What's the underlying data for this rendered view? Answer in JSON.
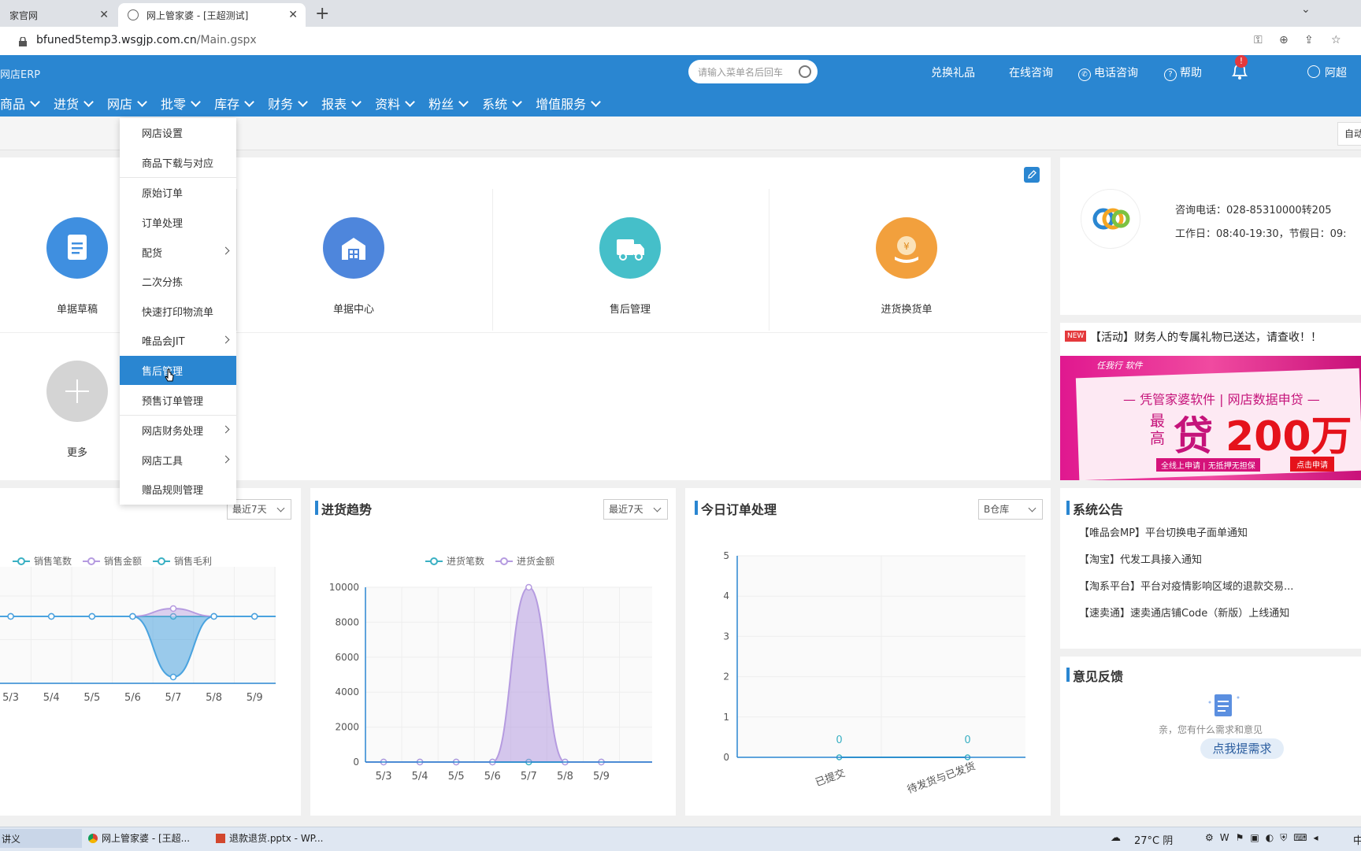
{
  "browser": {
    "tabs": [
      {
        "label": "家官网"
      },
      {
        "label": "网上管家婆 - [王超测试]"
      }
    ],
    "url_host": "bfuned5temp3.wsgjp.com.cn",
    "url_path": "/Main.gspx"
  },
  "header": {
    "logo_text": "网店ERP",
    "search_placeholder": "请输入菜单名后回车",
    "links": {
      "exchange": "兑换礼品",
      "online": "在线咨询",
      "phone": "电话咨询",
      "help": "帮助",
      "user": "阿超"
    },
    "notification_badge": "!"
  },
  "nav": [
    "商品",
    "进货",
    "网店",
    "批零",
    "库存",
    "财务",
    "报表",
    "资料",
    "粉丝",
    "系统",
    "增值服务"
  ],
  "subbar": {
    "auto_label": "自动"
  },
  "dropdown": {
    "items": [
      {
        "label": "网店设置"
      },
      {
        "label": "商品下载与对应"
      },
      {
        "label": "原始订单"
      },
      {
        "label": "订单处理"
      },
      {
        "label": "配货"
      },
      {
        "label": "二次分拣"
      },
      {
        "label": "快速打印物流单"
      },
      {
        "label": "唯品会JIT"
      },
      {
        "label": "售后管理"
      },
      {
        "label": "预售订单管理"
      },
      {
        "label": "网店财务处理"
      },
      {
        "label": "网店工具"
      },
      {
        "label": "赠品规则管理"
      }
    ]
  },
  "quick_access": {
    "items": [
      {
        "label": "单据草稿",
        "icon": "document-icon"
      },
      {
        "label": "单据中心",
        "icon": "warehouse-icon"
      },
      {
        "label": "售后管理",
        "icon": "truck-icon"
      },
      {
        "label": "进货换货单",
        "icon": "money-bag-icon"
      },
      {
        "label": "更多",
        "icon": "plus-icon"
      }
    ]
  },
  "contact": {
    "phone": "咨询电话：028-85310000转205",
    "hours": "工作日：08:40-19:30，节假日：09:"
  },
  "promo": {
    "new_tag": "NEW",
    "headline": "【活动】财务人的专属礼物已送达，请查收！！",
    "banner_brand": "任我行 软件",
    "banner_line1": "— 凭管家婆软件 | 网店数据申贷 —",
    "banner_big_a": "最高",
    "banner_big_b": "贷",
    "banner_big_c": "200万",
    "banner_sub": "全线上申请 | 无抵押无担保",
    "banner_btn": "点击申请"
  },
  "sales_chart": {
    "range_label": "最近7天",
    "legend": [
      "销售笔数",
      "销售金额",
      "销售毛利"
    ]
  },
  "purchase_chart": {
    "title": "进货趋势",
    "range_label": "最近7天"
  },
  "orders_chart": {
    "title": "今日订单处理",
    "warehouse_label": "B仓库"
  },
  "chart_data": [
    {
      "type": "area",
      "categories": [
        "5/3",
        "5/4",
        "5/5",
        "5/6",
        "5/7",
        "5/8",
        "5/9"
      ],
      "series": [
        {
          "name": "销售笔数",
          "color": "#3ab0c3",
          "values": [
            0,
            0,
            0,
            0,
            0,
            0,
            0
          ]
        },
        {
          "name": "销售金额",
          "color": "#b59be0",
          "values": [
            0,
            0,
            0,
            0,
            120,
            0,
            0
          ]
        },
        {
          "name": "销售毛利",
          "color": "#4aa3df",
          "values": [
            0,
            0,
            0,
            0,
            -2000,
            0,
            0
          ]
        }
      ]
    },
    {
      "type": "area",
      "categories": [
        "5/3",
        "5/4",
        "5/5",
        "5/6",
        "5/7",
        "5/8",
        "5/9"
      ],
      "yticks": [
        "0",
        "2000",
        "4000",
        "6000",
        "8000",
        "10000"
      ],
      "ylim": [
        0,
        10000
      ],
      "series": [
        {
          "name": "进货笔数",
          "color": "#3ab0c3",
          "values": [
            0,
            0,
            0,
            0,
            0,
            0,
            0
          ]
        },
        {
          "name": "进货金额",
          "color": "#b59be0",
          "values": [
            0,
            0,
            0,
            0,
            10000,
            0,
            0
          ]
        }
      ]
    },
    {
      "type": "line",
      "categories": [
        "已提交",
        "待发货与已发货"
      ],
      "yticks": [
        "0",
        "1",
        "2",
        "3",
        "4",
        "5"
      ],
      "ylim": [
        0,
        5
      ],
      "values": [
        0,
        0
      ],
      "data_labels": [
        "0",
        "0"
      ]
    }
  ],
  "announcements": {
    "title": "系统公告",
    "items": [
      {
        "text": "【唯品会MP】平台切换电子面单通知"
      },
      {
        "text": "【淘宝】代发工具接入通知"
      },
      {
        "text": "【淘系平台】平台对疫情影响区域的退款交易..."
      },
      {
        "text": "【速卖通】速卖通店铺Code（新版）上线通知"
      }
    ]
  },
  "feedback": {
    "title": "意见反馈",
    "prompt": "亲，您有什么需求和意见",
    "button": "点我提需求"
  },
  "taskbar": {
    "items": [
      "讲义",
      "网上管家婆 - [王超...",
      "退款退货.pptx - WP..."
    ],
    "weather": "27°C 阴",
    "ime": "中"
  }
}
